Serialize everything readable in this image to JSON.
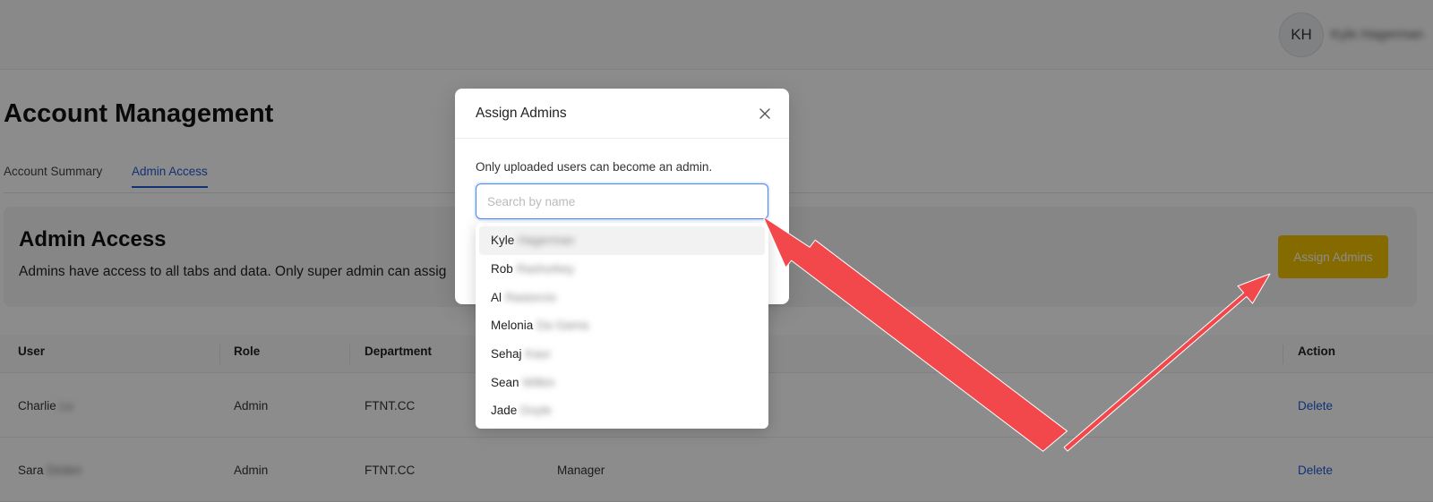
{
  "header": {
    "avatar_initials": "KH",
    "user_name": "Kyle Hagerman"
  },
  "page": {
    "title": "Account Management",
    "tabs": [
      {
        "label": "Account Summary",
        "active": false
      },
      {
        "label": "Admin Access",
        "active": true
      }
    ]
  },
  "admin_card": {
    "title": "Admin Access",
    "description": "Admins have access to all tabs and data. Only super admin can assig",
    "assign_button": "Assign Admins",
    "button_color": "#f2c200"
  },
  "table": {
    "columns": [
      "User",
      "Role",
      "Department",
      "Action"
    ],
    "rows": [
      {
        "first": "Charlie",
        "last": "Lu",
        "role": "Admin",
        "department": "FTNT.CC",
        "title": "",
        "action": "Delete"
      },
      {
        "first": "Sara",
        "last": "Dinten",
        "role": "Admin",
        "department": "FTNT.CC",
        "title": "Manager",
        "action": "Delete"
      }
    ]
  },
  "modal": {
    "title": "Assign Admins",
    "description": "Only uploaded users can become an admin.",
    "search_placeholder": "Search by name",
    "search_value": ""
  },
  "dropdown": {
    "options": [
      {
        "first": "Kyle",
        "last": "Hagerman"
      },
      {
        "first": "Rob",
        "last": "Rashorkey"
      },
      {
        "first": "Al",
        "last": "Rastorcio"
      },
      {
        "first": "Melonia",
        "last": "Da Gama"
      },
      {
        "first": "Sehaj",
        "last": "Kaur"
      },
      {
        "first": "Sean",
        "last": "Wilkin"
      },
      {
        "first": "Jade",
        "last": "Doyle"
      }
    ]
  },
  "colors": {
    "accent": "#1f5bd6",
    "annotation_arrow": "#f2484b"
  }
}
